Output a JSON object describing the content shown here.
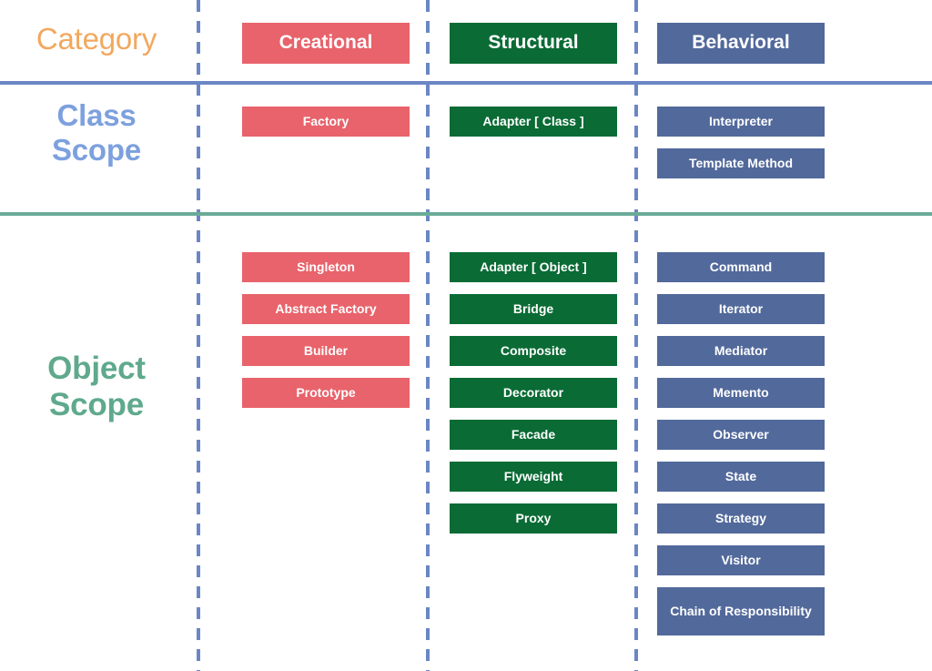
{
  "row_labels": {
    "category": "Category",
    "class_scope": "Class\nScope",
    "class_scope_line1": "Class",
    "class_scope_line2": "Scope",
    "object_scope_line1": "Object",
    "object_scope_line2": "Scope"
  },
  "colors": {
    "creational": "#e8636b",
    "structural": "#0a6b35",
    "behavioral": "#52699b",
    "category_label": "#f2a85f",
    "class_scope_label": "#7da0de",
    "object_scope_label": "#5fa98c",
    "divider_blue": "#6b86c4",
    "divider_green": "#6aab97",
    "dash_line": "#6b86c4",
    "background": "#ffffff"
  },
  "columns": [
    {
      "key": "creational",
      "header": "Creational",
      "class_scope": [
        "Factory"
      ],
      "object_scope": [
        "Singleton",
        "Abstract Factory",
        "Builder",
        "Prototype"
      ]
    },
    {
      "key": "structural",
      "header": "Structural",
      "class_scope": [
        "Adapter [ Class ]"
      ],
      "object_scope": [
        "Adapter [ Object ]",
        "Bridge",
        "Composite",
        "Decorator",
        "Facade",
        "Flyweight",
        "Proxy"
      ]
    },
    {
      "key": "behavioral",
      "header": "Behavioral",
      "class_scope": [
        "Interpreter",
        "Template Method"
      ],
      "object_scope": [
        "Command",
        "Iterator",
        "Mediator",
        "Memento",
        "Observer",
        "State",
        "Strategy",
        "Visitor",
        "Chain of Responsibility"
      ]
    }
  ]
}
